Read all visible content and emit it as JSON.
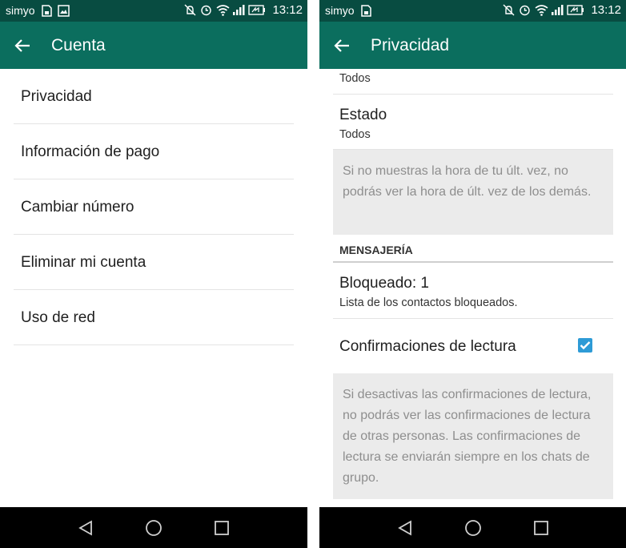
{
  "status_bar": {
    "carrier": "simyo",
    "time": "13:12",
    "color": "#084c41"
  },
  "left_screen": {
    "title": "Cuenta",
    "toolbar_color": "#0b6e5e",
    "items": [
      {
        "label": "Privacidad"
      },
      {
        "label": "Información de pago"
      },
      {
        "label": "Cambiar número"
      },
      {
        "label": "Eliminar mi cuenta"
      },
      {
        "label": "Uso de red"
      }
    ]
  },
  "right_screen": {
    "title": "Privacidad",
    "partial_value": "Todos",
    "estado": {
      "title": "Estado",
      "value": "Todos"
    },
    "last_seen_note": "Si no muestras la hora de tu últ. vez, no podrás ver la hora de últ. vez de los demás.",
    "section_header": "MENSAJERÍA",
    "blocked": {
      "title": "Bloqueado: 1",
      "summary": "Lista de los contactos bloqueados."
    },
    "read_receipts": {
      "title": "Confirmaciones de lectura",
      "checked": true
    },
    "read_receipts_note": "Si desactivas las confirmaciones de lectura, no podrás ver las confirmaciones de lectura de otras personas. Las confirmaciones de lectura se enviarán siempre en los chats de grupo.",
    "checkbox_color": "#2e9bd6"
  },
  "icons": {
    "back": "arrow-back-icon",
    "status": [
      "image-icon",
      "silent-icon",
      "alarm-icon",
      "wifi-icon",
      "signal-icon",
      "battery-icon"
    ],
    "nav": [
      "nav-back-icon",
      "nav-home-icon",
      "nav-recents-icon"
    ]
  }
}
